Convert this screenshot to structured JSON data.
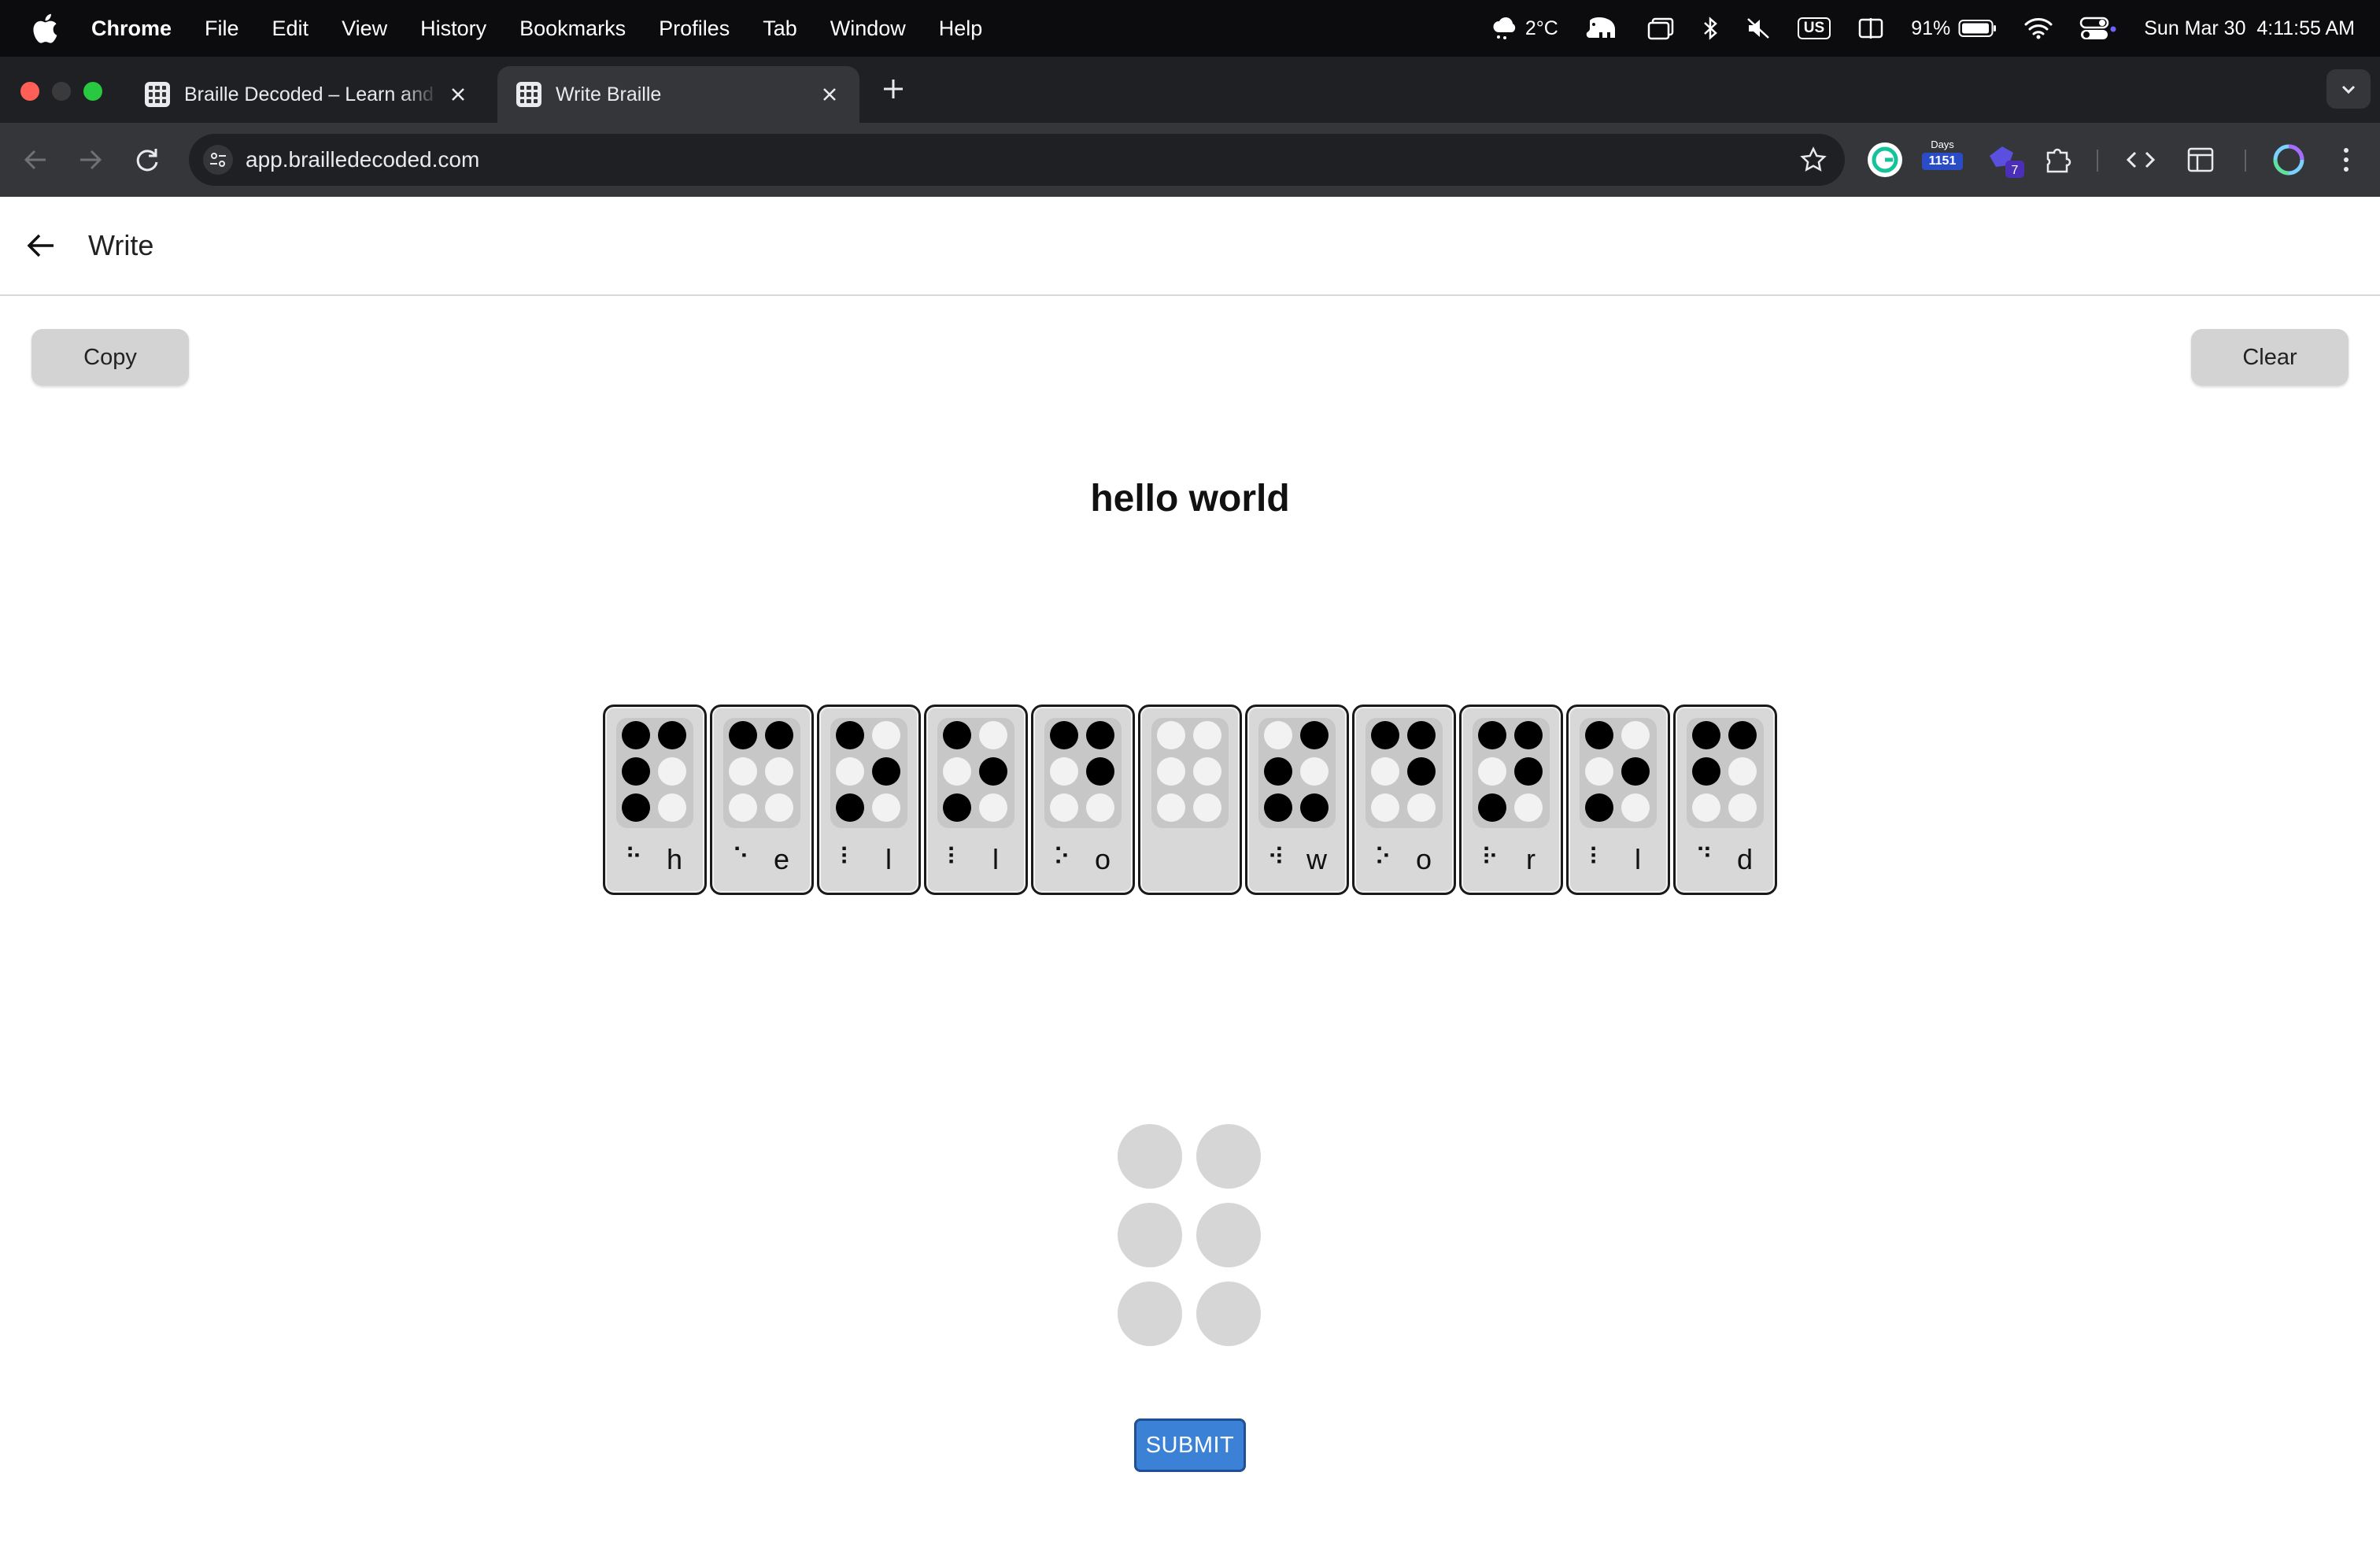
{
  "menubar": {
    "app_name": "Chrome",
    "items": [
      "File",
      "Edit",
      "View",
      "History",
      "Bookmarks",
      "Profiles",
      "Tab",
      "Window",
      "Help"
    ],
    "weather": "2°C",
    "input_source": "US",
    "battery": "91%",
    "datetime": "Sun Mar 30  4:11:55 AM"
  },
  "browser": {
    "tabs": [
      {
        "title": "Braille Decoded – Learn and T",
        "active": false
      },
      {
        "title": "Write Braille",
        "active": true
      }
    ],
    "url": "app.brailledecoded.com",
    "extensions": {
      "days_label": "Days",
      "days_count": "1151",
      "ext_badge": "7"
    }
  },
  "page": {
    "title": "Write",
    "copy_label": "Copy",
    "clear_label": "Clear",
    "written_text": "hello world",
    "submit_label": "SUBMIT",
    "cells": [
      {
        "letter": "h",
        "glyph": "⠓",
        "dots": [
          1,
          1,
          1,
          1,
          0,
          0
        ]
      },
      {
        "letter": "e",
        "glyph": "⠑",
        "dots": [
          1,
          0,
          0,
          1,
          0,
          0
        ]
      },
      {
        "letter": "l",
        "glyph": "⠇",
        "dots": [
          1,
          0,
          1,
          0,
          1,
          0
        ]
      },
      {
        "letter": "l",
        "glyph": "⠇",
        "dots": [
          1,
          0,
          1,
          0,
          1,
          0
        ]
      },
      {
        "letter": "o",
        "glyph": "⠕",
        "dots": [
          1,
          0,
          0,
          1,
          1,
          0
        ]
      },
      {
        "letter": "",
        "glyph": "",
        "dots": [
          0,
          0,
          0,
          0,
          0,
          0
        ]
      },
      {
        "letter": "w",
        "glyph": "⠺",
        "dots": [
          0,
          1,
          1,
          1,
          0,
          1
        ]
      },
      {
        "letter": "o",
        "glyph": "⠕",
        "dots": [
          1,
          0,
          0,
          1,
          1,
          0
        ]
      },
      {
        "letter": "r",
        "glyph": "⠗",
        "dots": [
          1,
          0,
          1,
          1,
          1,
          0
        ]
      },
      {
        "letter": "l",
        "glyph": "⠇",
        "dots": [
          1,
          0,
          1,
          0,
          1,
          0
        ]
      },
      {
        "letter": "d",
        "glyph": "⠙",
        "dots": [
          1,
          1,
          0,
          1,
          0,
          0
        ]
      }
    ],
    "input_dots": [
      0,
      0,
      0,
      0,
      0,
      0
    ]
  },
  "colors": {
    "menubar_bg": "#0c0c0e",
    "tabstrip_bg": "#1f2024",
    "toolbar_bg": "#35363a",
    "submit_bg": "#3b82d6",
    "dot_on": "#000000",
    "dot_off": "#f2f2f2"
  }
}
